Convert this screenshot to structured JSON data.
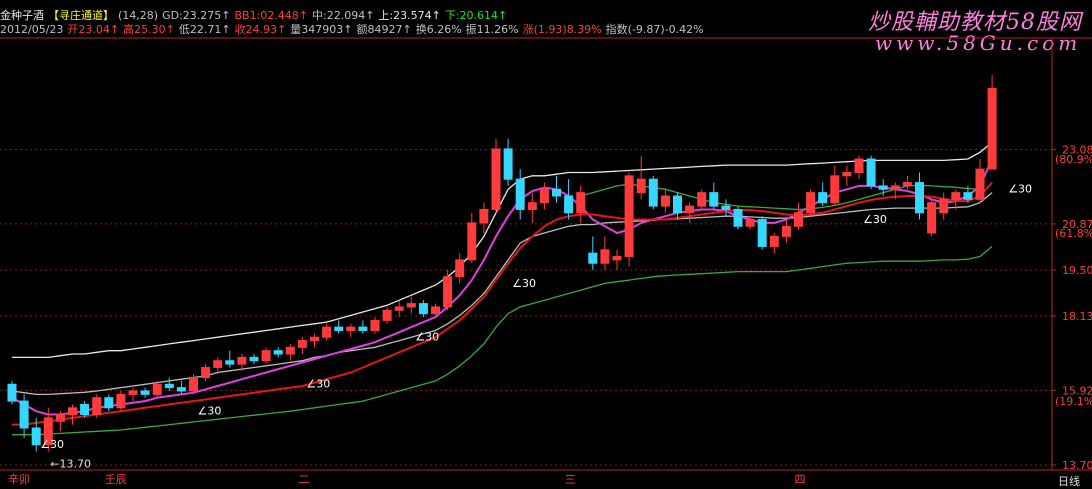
{
  "header": {
    "stock_name": "金种子酒",
    "indicator_name": "【寻庄通道】",
    "params": "(14,28)",
    "gd": "GD:23.275↑",
    "g": "BB1:02.448↑",
    "mid": "中:22.094↑",
    "up": "上:23.574↑",
    "down": "下:20.614↑",
    "date": "2012/05/23",
    "open": "开23.04↑",
    "high": "高25.30↑",
    "low": "低22.71↑",
    "close": "收24.93↑",
    "volume": "量347903↑",
    "amount": "额84927↑",
    "turnover": "换6.26%",
    "amplitude": "振11.26%",
    "change": "涨(1.93)8.39%",
    "index": "指数(-9.87)-0.42%"
  },
  "watermark": {
    "line1": "炒股輔助教材58股网",
    "line2": "www.58Gu.com"
  },
  "colors": {
    "up_candle": "#ff3b3b",
    "down_candle": "#35d6ff",
    "white_line": "#e8e8e8",
    "magenta_line": "#e040e0",
    "red_line": "#e01818",
    "green_line": "#2aa02a",
    "lower_band": "#3ca83c",
    "grid": "#8b1a1a"
  },
  "chart_data": {
    "type": "candlestick",
    "y_axis": {
      "ticks": [
        13.7,
        15.92,
        18.13,
        19.5,
        20.87,
        23.08
      ],
      "tick_labels": [
        "13.70",
        "15.92",
        "18.13",
        "19.50",
        "20.87",
        "23.08"
      ],
      "pct_labels": [
        {
          "value": 15.6,
          "label": "(19.1%)"
        },
        {
          "value": 20.6,
          "label": "(61.8%)"
        },
        {
          "value": 22.8,
          "label": "(80.9%)"
        }
      ],
      "ylim": [
        13.55,
        26.4
      ]
    },
    "x_labels": [
      {
        "index": 0,
        "label": "辛卯"
      },
      {
        "index": 8,
        "label": "壬辰"
      },
      {
        "index": 24,
        "label": "二"
      },
      {
        "index": 46,
        "label": "三"
      },
      {
        "index": 65,
        "label": "四"
      }
    ],
    "period_label": "日线",
    "low_marker": "13.70",
    "angle_label": "∠30",
    "candles": [
      [
        16.1,
        16.2,
        15.5,
        15.6
      ],
      [
        15.6,
        15.8,
        14.5,
        14.8
      ],
      [
        14.8,
        15.1,
        14.1,
        14.3
      ],
      [
        14.3,
        15.4,
        14.1,
        15.1
      ],
      [
        15.0,
        15.3,
        14.7,
        15.2
      ],
      [
        15.2,
        15.5,
        14.9,
        15.4
      ],
      [
        15.5,
        15.6,
        15.1,
        15.2
      ],
      [
        15.2,
        15.8,
        15.1,
        15.7
      ],
      [
        15.7,
        15.8,
        15.3,
        15.4
      ],
      [
        15.4,
        15.9,
        15.3,
        15.8
      ],
      [
        15.8,
        16.0,
        15.6,
        15.9
      ],
      [
        15.9,
        16.0,
        15.7,
        15.8
      ],
      [
        15.8,
        16.2,
        15.7,
        16.1
      ],
      [
        16.1,
        16.3,
        15.9,
        16.0
      ],
      [
        16.0,
        16.2,
        15.8,
        15.9
      ],
      [
        15.9,
        16.4,
        15.8,
        16.3
      ],
      [
        16.3,
        16.7,
        16.2,
        16.6
      ],
      [
        16.6,
        16.9,
        16.4,
        16.8
      ],
      [
        16.8,
        17.1,
        16.6,
        16.7
      ],
      [
        16.7,
        17.0,
        16.5,
        16.9
      ],
      [
        16.9,
        17.0,
        16.7,
        16.8
      ],
      [
        16.8,
        17.2,
        16.7,
        17.1
      ],
      [
        17.1,
        17.2,
        16.9,
        17.0
      ],
      [
        17.0,
        17.3,
        16.8,
        17.2
      ],
      [
        17.2,
        17.5,
        17.0,
        17.4
      ],
      [
        17.4,
        17.6,
        17.2,
        17.5
      ],
      [
        17.5,
        17.9,
        17.4,
        17.8
      ],
      [
        17.8,
        18.0,
        17.6,
        17.7
      ],
      [
        17.7,
        17.9,
        17.5,
        17.8
      ],
      [
        17.8,
        18.0,
        17.6,
        17.7
      ],
      [
        17.7,
        18.1,
        17.6,
        18.0
      ],
      [
        18.0,
        18.4,
        17.9,
        18.3
      ],
      [
        18.3,
        18.6,
        18.1,
        18.4
      ],
      [
        18.4,
        18.7,
        18.2,
        18.5
      ],
      [
        18.5,
        18.6,
        18.1,
        18.2
      ],
      [
        18.2,
        18.5,
        18.1,
        18.4
      ],
      [
        18.4,
        19.5,
        18.3,
        19.3
      ],
      [
        19.3,
        20.0,
        19.1,
        19.8
      ],
      [
        19.8,
        21.2,
        19.7,
        20.9
      ],
      [
        20.9,
        21.5,
        20.6,
        21.3
      ],
      [
        21.3,
        23.4,
        21.2,
        23.1
      ],
      [
        23.1,
        23.4,
        22.0,
        22.2
      ],
      [
        22.2,
        22.5,
        21.0,
        21.3
      ],
      [
        21.3,
        21.8,
        20.9,
        21.5
      ],
      [
        21.5,
        22.1,
        21.3,
        21.9
      ],
      [
        21.9,
        22.3,
        21.5,
        21.7
      ],
      [
        21.7,
        22.2,
        21.0,
        21.2
      ],
      [
        21.2,
        22.0,
        20.9,
        21.8
      ],
      [
        20.0,
        20.5,
        19.5,
        19.7
      ],
      [
        19.7,
        20.5,
        19.5,
        20.1
      ],
      [
        19.8,
        20.1,
        19.5,
        19.9
      ],
      [
        19.9,
        22.4,
        19.6,
        22.3
      ],
      [
        21.8,
        22.9,
        21.6,
        22.2
      ],
      [
        22.2,
        22.3,
        21.3,
        21.4
      ],
      [
        21.4,
        21.9,
        21.2,
        21.7
      ],
      [
        21.7,
        21.8,
        21.0,
        21.2
      ],
      [
        21.2,
        21.5,
        20.9,
        21.4
      ],
      [
        21.4,
        21.9,
        21.3,
        21.8
      ],
      [
        21.8,
        22.1,
        21.3,
        21.4
      ],
      [
        21.4,
        21.6,
        21.1,
        21.3
      ],
      [
        21.3,
        21.4,
        20.7,
        20.8
      ],
      [
        20.8,
        21.1,
        20.7,
        21.0
      ],
      [
        21.0,
        21.1,
        20.1,
        20.2
      ],
      [
        20.2,
        20.6,
        20.0,
        20.5
      ],
      [
        20.5,
        21.0,
        20.3,
        20.8
      ],
      [
        20.8,
        21.5,
        20.7,
        21.2
      ],
      [
        21.2,
        21.9,
        21.1,
        21.8
      ],
      [
        21.8,
        22.1,
        21.4,
        21.5
      ],
      [
        21.5,
        22.6,
        21.4,
        22.3
      ],
      [
        22.3,
        22.6,
        22.0,
        22.4
      ],
      [
        22.4,
        22.9,
        22.2,
        22.8
      ],
      [
        22.8,
        22.9,
        21.9,
        22.0
      ],
      [
        22.0,
        22.2,
        21.7,
        21.9
      ],
      [
        21.9,
        22.1,
        21.6,
        22.0
      ],
      [
        22.0,
        22.3,
        21.9,
        22.1
      ],
      [
        22.1,
        22.4,
        21.0,
        21.2
      ],
      [
        20.6,
        21.6,
        20.5,
        21.5
      ],
      [
        21.2,
        21.8,
        21.0,
        21.6
      ],
      [
        21.6,
        21.9,
        21.3,
        21.8
      ],
      [
        21.8,
        22.0,
        21.5,
        21.6
      ],
      [
        21.6,
        22.8,
        21.5,
        22.5
      ],
      [
        22.5,
        25.3,
        22.7,
        24.9
      ]
    ],
    "series": [
      {
        "name": "上",
        "color": "white",
        "values": [
          16.9,
          16.9,
          16.9,
          16.9,
          16.95,
          17.0,
          17.0,
          17.05,
          17.1,
          17.1,
          17.15,
          17.2,
          17.25,
          17.3,
          17.35,
          17.4,
          17.45,
          17.5,
          17.55,
          17.6,
          17.65,
          17.7,
          17.75,
          17.8,
          17.85,
          17.9,
          17.95,
          18.05,
          18.15,
          18.25,
          18.35,
          18.45,
          18.6,
          18.75,
          18.9,
          19.05,
          19.3,
          19.6,
          20.0,
          20.5,
          21.2,
          21.9,
          22.2,
          22.3,
          22.3,
          22.35,
          22.4,
          22.4,
          22.4,
          22.42,
          22.44,
          22.46,
          22.48,
          22.5,
          22.52,
          22.54,
          22.56,
          22.58,
          22.6,
          22.62,
          22.62,
          22.62,
          22.62,
          22.62,
          22.62,
          22.64,
          22.66,
          22.68,
          22.7,
          22.72,
          22.74,
          22.76,
          22.76,
          22.76,
          22.76,
          22.76,
          22.76,
          22.76,
          22.78,
          22.8,
          23.0,
          23.3
        ]
      },
      {
        "name": "中",
        "color": "gray",
        "values": [
          15.9,
          15.85,
          15.8,
          15.8,
          15.82,
          15.84,
          15.86,
          15.9,
          15.95,
          16.0,
          16.05,
          16.1,
          16.15,
          16.2,
          16.25,
          16.3,
          16.35,
          16.45,
          16.5,
          16.55,
          16.6,
          16.65,
          16.7,
          16.75,
          16.8,
          16.9,
          16.95,
          17.05,
          17.1,
          17.15,
          17.2,
          17.3,
          17.4,
          17.5,
          17.6,
          17.7,
          17.9,
          18.15,
          18.45,
          18.8,
          19.3,
          19.8,
          20.3,
          20.5,
          20.6,
          20.7,
          20.8,
          20.85,
          20.85,
          20.9,
          20.92,
          20.94,
          20.96,
          20.98,
          21.0,
          21.02,
          21.04,
          21.06,
          21.08,
          21.1,
          21.1,
          21.08,
          21.06,
          21.04,
          21.04,
          21.06,
          21.1,
          21.14,
          21.18,
          21.22,
          21.26,
          21.3,
          21.32,
          21.34,
          21.34,
          21.34,
          21.34,
          21.34,
          21.36,
          21.38,
          21.5,
          21.8
        ]
      },
      {
        "name": "下",
        "color": "green",
        "values": [
          14.6,
          14.6,
          14.6,
          14.62,
          14.64,
          14.66,
          14.68,
          14.7,
          14.72,
          14.74,
          14.78,
          14.82,
          14.86,
          14.9,
          14.94,
          14.98,
          15.02,
          15.06,
          15.1,
          15.14,
          15.18,
          15.22,
          15.26,
          15.3,
          15.35,
          15.4,
          15.45,
          15.5,
          15.55,
          15.6,
          15.7,
          15.8,
          15.9,
          16.0,
          16.1,
          16.2,
          16.4,
          16.65,
          16.95,
          17.3,
          17.8,
          18.2,
          18.4,
          18.5,
          18.6,
          18.7,
          18.8,
          18.9,
          19.0,
          19.1,
          19.15,
          19.2,
          19.25,
          19.3,
          19.33,
          19.35,
          19.37,
          19.39,
          19.41,
          19.43,
          19.45,
          19.45,
          19.45,
          19.45,
          19.45,
          19.5,
          19.55,
          19.6,
          19.65,
          19.7,
          19.72,
          19.74,
          19.76,
          19.76,
          19.76,
          19.76,
          19.78,
          19.8,
          19.8,
          19.82,
          19.9,
          20.2
        ]
      },
      {
        "name": "GD",
        "color": "magenta",
        "values": [
          15.7,
          15.5,
          15.3,
          15.2,
          15.2,
          15.25,
          15.3,
          15.4,
          15.45,
          15.5,
          15.55,
          15.6,
          15.7,
          15.75,
          15.8,
          15.85,
          15.95,
          16.05,
          16.15,
          16.25,
          16.35,
          16.45,
          16.55,
          16.65,
          16.75,
          16.85,
          16.95,
          17.05,
          17.15,
          17.25,
          17.35,
          17.5,
          17.65,
          17.8,
          17.95,
          18.1,
          18.4,
          18.75,
          19.2,
          19.8,
          20.5,
          21.1,
          21.6,
          21.85,
          21.95,
          21.9,
          21.7,
          21.4,
          21.0,
          20.8,
          20.6,
          20.7,
          20.9,
          21.0,
          21.1,
          21.2,
          21.25,
          21.3,
          21.3,
          21.25,
          21.1,
          21.0,
          20.9,
          20.9,
          21.0,
          21.2,
          21.4,
          21.6,
          21.8,
          21.9,
          22.0,
          22.0,
          21.95,
          21.9,
          21.85,
          21.75,
          21.6,
          21.5,
          21.55,
          21.7,
          22.0,
          22.8
        ]
      },
      {
        "name": "BB1",
        "color": "red",
        "values": [
          14.9,
          14.9,
          14.95,
          15.0,
          15.05,
          15.1,
          15.15,
          15.2,
          15.25,
          15.3,
          15.35,
          15.4,
          15.45,
          15.5,
          15.55,
          15.6,
          15.65,
          15.7,
          15.75,
          15.8,
          15.85,
          15.9,
          15.95,
          16.0,
          16.05,
          16.15,
          16.25,
          16.35,
          16.45,
          16.6,
          16.75,
          16.9,
          17.05,
          17.2,
          17.35,
          17.5,
          17.75,
          18.0,
          18.35,
          18.7,
          19.2,
          19.7,
          20.15,
          20.5,
          20.8,
          21.0,
          21.1,
          21.15,
          21.15,
          21.1,
          21.05,
          21.0,
          21.0,
          21.0,
          21.0,
          21.05,
          21.1,
          21.15,
          21.2,
          21.25,
          21.28,
          21.28,
          21.25,
          21.2,
          21.15,
          21.12,
          21.15,
          21.2,
          21.3,
          21.4,
          21.5,
          21.58,
          21.64,
          21.68,
          21.7,
          21.7,
          21.68,
          21.62,
          21.55,
          21.55,
          21.7,
          22.1
        ]
      },
      {
        "name": "green_seg",
        "color": "green",
        "start": 47,
        "values": [
          21.7,
          21.8,
          21.9,
          22.0,
          22.05,
          22.0,
          21.95,
          21.9,
          21.8,
          21.7,
          21.6,
          21.5,
          21.45,
          21.4,
          21.38,
          21.36,
          21.34,
          21.32,
          21.3,
          21.32,
          21.36,
          21.42,
          21.5,
          21.6,
          21.7,
          21.8,
          21.9,
          22.0,
          22.02,
          22.0,
          21.98,
          21.96,
          21.92,
          21.9
        ]
      }
    ]
  }
}
